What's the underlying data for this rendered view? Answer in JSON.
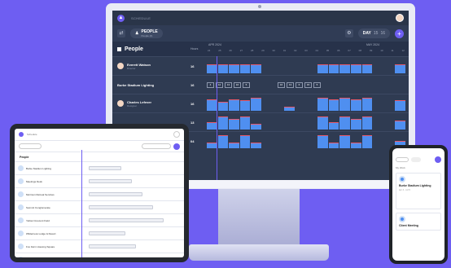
{
  "desktop": {
    "nav_label": "SCHEDULE",
    "filter": {
      "label": "PEOPLE",
      "sub": "People (4)"
    },
    "view": {
      "label": "DAY",
      "nums": [
        "15",
        "16"
      ]
    },
    "header": {
      "title": "People",
      "hours_label": "Hours",
      "month_left": "APR 2024",
      "month_right": "MAY 2024"
    },
    "days": [
      "24",
      "25",
      "26",
      "27",
      "28",
      "29",
      "30",
      "01",
      "02",
      "03",
      "04",
      "05",
      "06",
      "07",
      "08",
      "09",
      "10",
      "11",
      "12"
    ],
    "rows": [
      {
        "name": "Everett Watson",
        "sub": "Director",
        "hours": "16",
        "bars": [
          0.6,
          0.6,
          0.6,
          0.6,
          0.6,
          0,
          0,
          0,
          0,
          0,
          0.6,
          0.6,
          0.6,
          0.6,
          0.6,
          0,
          0,
          0.6
        ]
      },
      {
        "name": "Burke Stadium Lighting",
        "sub": "",
        "hours": "16",
        "tasks": [
          "4",
          "12",
          "13",
          "16",
          "5"
        ],
        "tasks_right": [
          "16",
          "13",
          "6",
          "15",
          "5"
        ]
      },
      {
        "name": "Charles Lefever",
        "sub": "Designer",
        "hours": "16",
        "bars": [
          0.8,
          0.6,
          0.8,
          0.7,
          0.9,
          0,
          0,
          0.3,
          0,
          0,
          0.9,
          0.8,
          0.9,
          0.8,
          0.9,
          0,
          0,
          0.7
        ]
      },
      {
        "name": "",
        "sub": "",
        "hours": "13",
        "bars": [
          0.5,
          0.9,
          0.7,
          0.9,
          0.4,
          0,
          0,
          0,
          0,
          0,
          0.9,
          0.5,
          0.9,
          0.7,
          0.9,
          0,
          0,
          0.6
        ]
      },
      {
        "name": "",
        "sub": "",
        "hours": "04",
        "bars": [
          0.4,
          0.9,
          0.4,
          0.9,
          0.4,
          0,
          0,
          0,
          0,
          0,
          0.9,
          0.4,
          0.9,
          0.4,
          0.9,
          0,
          0,
          0.5
        ]
      }
    ]
  },
  "tablet": {
    "title": "Schedule",
    "column": "People",
    "rows": [
      "Burke Stadium Lighting",
      "Meetings Desk",
      "Morrison Retreat Services",
      "Summit Conglomerate",
      "Yellow Crescent Field",
      "Wilderness Lodge & Resort",
      "Fox Farm Housing Square",
      "Whispering Willow Gardens"
    ]
  },
  "phone": {
    "label": "My Work",
    "card1": {
      "title": "Burke Stadium Lighting",
      "meta": "Apr 3 - 11 Hr"
    },
    "card2": {
      "title": "Client Meeting"
    }
  }
}
